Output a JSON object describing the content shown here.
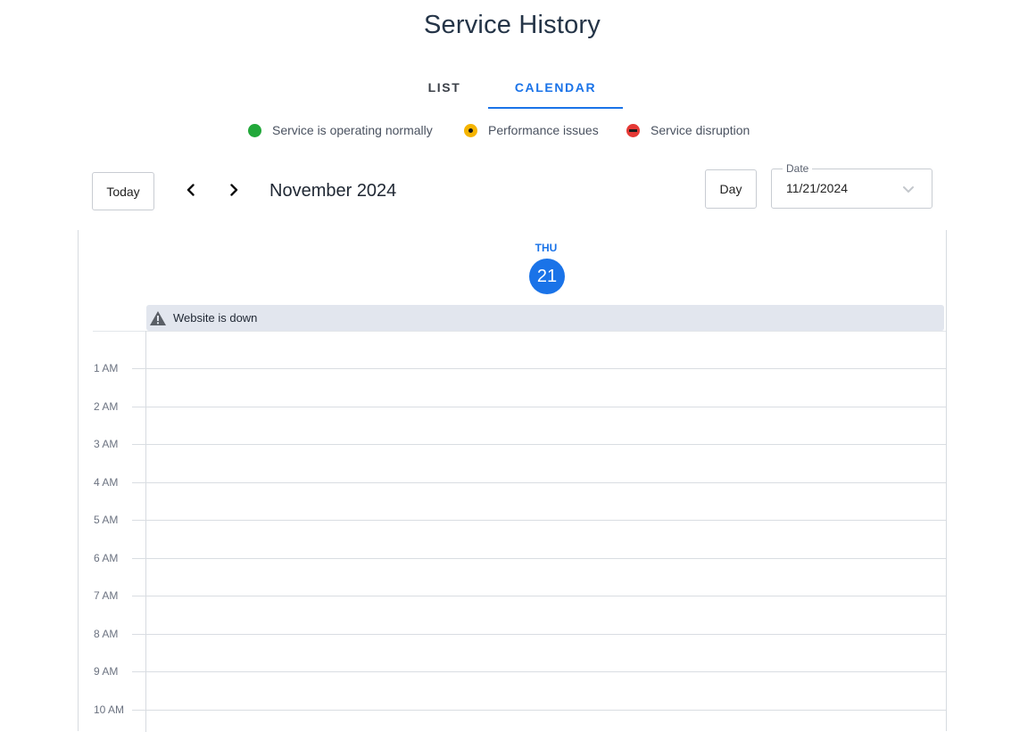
{
  "page": {
    "title": "Service History"
  },
  "tabs": [
    {
      "label": "LIST",
      "active": false
    },
    {
      "label": "CALENDAR",
      "active": true
    }
  ],
  "legend": [
    {
      "label": "Service is operating normally",
      "icon": "status-normal-icon",
      "color": "#22a83a"
    },
    {
      "label": "Performance issues",
      "icon": "status-performance-icon",
      "color": "#f5b400"
    },
    {
      "label": "Service disruption",
      "icon": "status-disruption-icon",
      "color": "#e53935"
    }
  ],
  "toolbar": {
    "today_label": "Today",
    "month_label": "November 2024",
    "view_label": "Day",
    "date_field_label": "Date",
    "date_value": "11/21/2024"
  },
  "calendar": {
    "day_name": "THU",
    "day_number": "21",
    "allday_event": "Website is down",
    "hours": [
      "1 AM",
      "2 AM",
      "3 AM",
      "4 AM",
      "5 AM",
      "6 AM",
      "7 AM",
      "8 AM",
      "9 AM",
      "10 AM"
    ]
  },
  "colors": {
    "accent": "#1a73e8",
    "event_bg": "#e2e6ee"
  }
}
